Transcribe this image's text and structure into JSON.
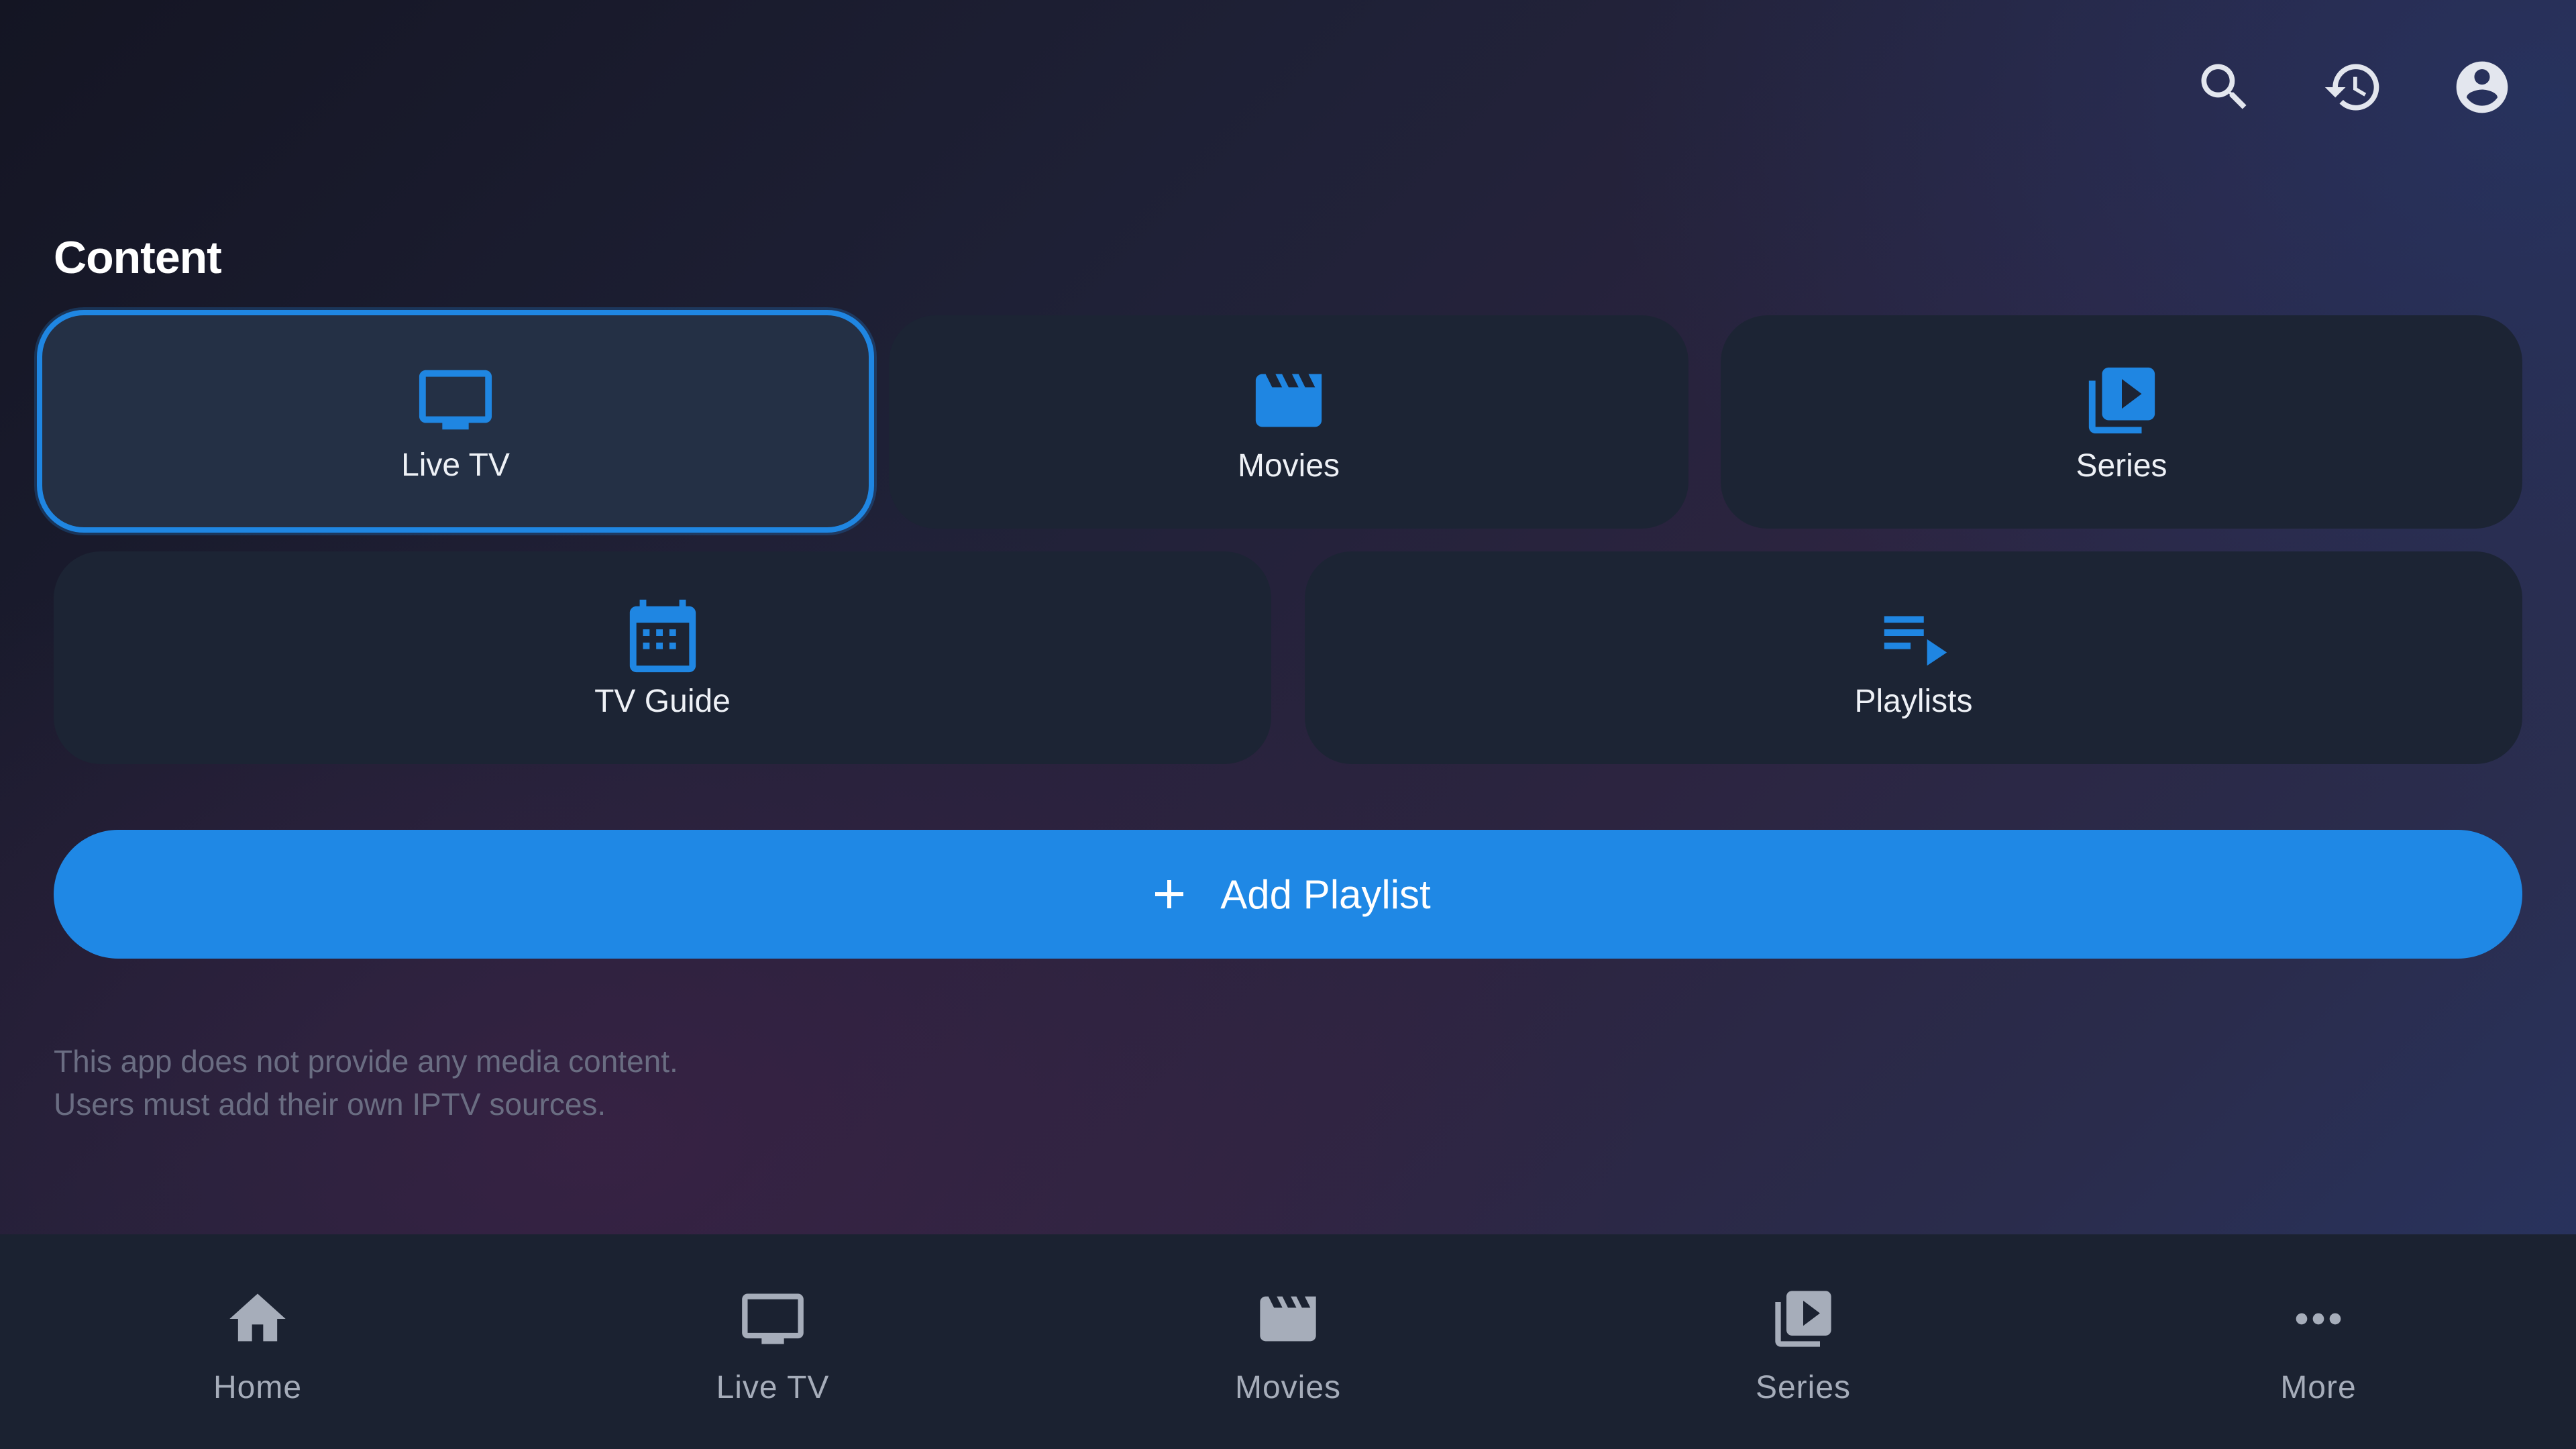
{
  "header": {
    "icons": [
      "search-icon",
      "history-icon",
      "account-icon"
    ]
  },
  "content": {
    "title": "Content",
    "tiles": [
      {
        "label": "Live TV",
        "icon": "tv-icon",
        "focused": true
      },
      {
        "label": "Movies",
        "icon": "movie-icon",
        "focused": false
      },
      {
        "label": "Series",
        "icon": "video-library-icon",
        "focused": false
      },
      {
        "label": "TV Guide",
        "icon": "calendar-icon",
        "focused": false
      },
      {
        "label": "Playlists",
        "icon": "playlist-play-icon",
        "focused": false
      }
    ]
  },
  "actions": {
    "add_playlist_label": "Add Playlist"
  },
  "disclaimer": {
    "line1": "This app does not provide any media content.",
    "line2": "Users must add their own IPTV sources."
  },
  "bottom_nav": {
    "items": [
      {
        "label": "Home",
        "icon": "home-icon"
      },
      {
        "label": "Live TV",
        "icon": "tv-icon"
      },
      {
        "label": "Movies",
        "icon": "movie-icon"
      },
      {
        "label": "Series",
        "icon": "video-library-icon"
      },
      {
        "label": "More",
        "icon": "more-horiz-icon"
      }
    ]
  },
  "colors": {
    "accent": "#1f86e2",
    "tile_bg": "#1c2434",
    "nav_bg": "#1b2231",
    "muted_text": "#6a6d82"
  }
}
